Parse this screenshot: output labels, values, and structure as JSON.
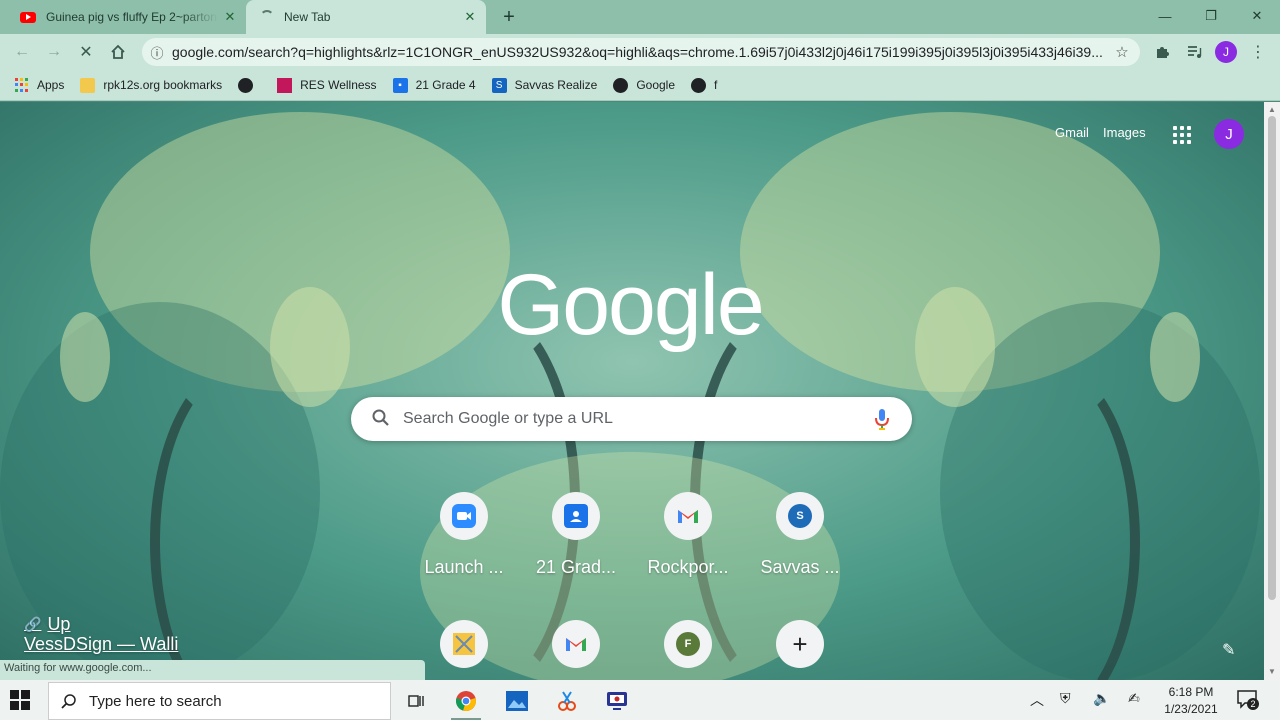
{
  "tabs": [
    {
      "title": "Guinea pig vs fluffy Ep 2~partonl",
      "icon": "youtube-icon"
    },
    {
      "title": "New Tab",
      "icon": "loading-spinner-icon"
    }
  ],
  "address_bar": {
    "url": "google.com/search?q=highlights&rlz=1C1ONGR_enUS932US932&oq=highli&aqs=chrome.1.69i57j0i433l2j0j46i175i199i395j0i395l3j0i395i433j46i39..."
  },
  "toolbar": {
    "profile_initial": "J"
  },
  "bookmarks": [
    {
      "label": "Apps",
      "icon": "apps-grid-icon"
    },
    {
      "label": "rpk12s.org bookmarks",
      "icon": "folder-icon"
    },
    {
      "label": "",
      "icon": "globe-icon"
    },
    {
      "label": "RES Wellness",
      "icon": "res-wellness-icon"
    },
    {
      "label": "21 Grade 4",
      "icon": "google-classroom-icon"
    },
    {
      "label": "Savvas Realize",
      "icon": "savvas-icon"
    },
    {
      "label": "Google",
      "icon": "globe-icon"
    },
    {
      "label": "f",
      "icon": "globe-icon"
    }
  ],
  "ntp": {
    "gmail": "Gmail",
    "images": "Images",
    "avatar_initial": "J",
    "logo": "Google",
    "search_placeholder": "Search Google or type a URL",
    "shortcuts": [
      {
        "label": "Launch ...",
        "icon": "zoom-icon"
      },
      {
        "label": "21 Grad...",
        "icon": "classroom-icon"
      },
      {
        "label": "Rockpor...",
        "icon": "gmail-icon"
      },
      {
        "label": "Savvas ...",
        "icon": "savvas-s-icon",
        "letter": "S"
      },
      {
        "label": "",
        "icon": "yellow-app-icon"
      },
      {
        "label": "",
        "icon": "gmail-icon"
      },
      {
        "label": "",
        "icon": "letter-f-icon",
        "letter": "F"
      },
      {
        "label": "",
        "icon": "add-shortcut-icon"
      }
    ],
    "attribution_line1": "Up",
    "attribution_line2": "VessDSign — Walli"
  },
  "status_bar": "Waiting for www.google.com...",
  "taskbar": {
    "search_placeholder": "Type here to search",
    "time": "6:18 PM",
    "date": "1/23/2021",
    "notification_count": "2"
  },
  "colors": {
    "profile": "#8a2be2",
    "youtube": "#ff0000",
    "chrome_frame": "#c9e5da"
  }
}
